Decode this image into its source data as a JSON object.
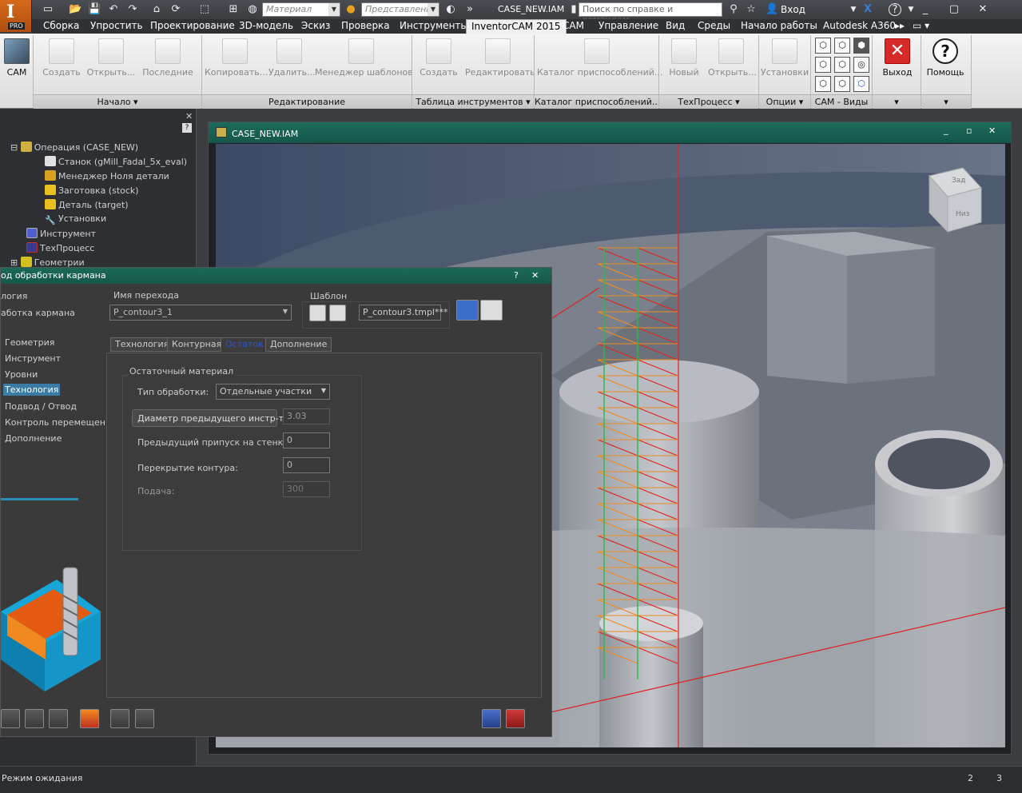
{
  "qat": {
    "material_placeholder": "Материал",
    "appearance_placeholder": "Представлени",
    "doc_title": "CASE_NEW.IAM",
    "help_search_placeholder": "Поиск по справке и командам...",
    "login": "Вход",
    "app_badge": "PRO"
  },
  "tabs": [
    "Сборка",
    "Упростить",
    "Проектирование",
    "3D-модель",
    "Эскиз",
    "Проверка",
    "Инструменты",
    "InventorCAM 2015",
    "CAM",
    "Управление",
    "Вид",
    "Среды",
    "Начало работы",
    "Autodesk A360"
  ],
  "ribbon": {
    "cam": "CAM",
    "create": "Создать",
    "open": "Открыть...",
    "recent": "Последние",
    "copy": "Копировать...",
    "delete": "Удалить...",
    "template_manager": "Менеджер шаблонов",
    "tool_create": "Создать",
    "tool_edit": "Редактировать",
    "fixture_catalog": "Каталог приспособлений...",
    "new": "Новый",
    "open2": "Открыть...",
    "settings": "Установки",
    "exit": "Выход",
    "help": "Помощь",
    "groups": {
      "start": "Начало",
      "editing": "Редактирование",
      "tool_table": "Таблица инструментов",
      "fixture_catalog": "Каталог приспособлений...",
      "techprocess": "ТехПроцесс",
      "options": "Опции",
      "cam_views": "CAM - Виды"
    }
  },
  "tree": {
    "operation": "Операция (CASE_NEW)",
    "machine": "Станок (gMill_Fadal_5x_eval)",
    "zero_manager": "Менеджер Ноля детали",
    "stock": "Заготовка (stock)",
    "target": "Деталь (target)",
    "setups": "Установки",
    "tool": "Инструмент",
    "techprocess": "ТехПроцесс",
    "geometry": "Геометрии"
  },
  "viewwin": {
    "title": "CASE_NEW.IAM",
    "viewcube_top": "Зад",
    "viewcube_bottom": "Низ"
  },
  "dialog": {
    "title": "од обработки кармана",
    "tech_label": "логия",
    "tech_value": "аботка кармана",
    "step_name_label": "Имя перехода",
    "step_name_value": "P_contour3_1",
    "template_label": "Шаблон",
    "template_value": "P_contour3.tmpl***",
    "nav": [
      "Геометрия",
      "Инструмент",
      "Уровни",
      "Технология",
      "Подвод / Отвод",
      "Контроль перемещени",
      "Дополнение"
    ],
    "tabs": [
      "Технология",
      "Контурная",
      "Остаток",
      "Дополнение"
    ],
    "group_title": "Остаточный материал",
    "machining_type_label": "Тип обработки:",
    "machining_type_value": "Отдельные участки",
    "prev_tool_diam_label": "Диаметр предыдущего инстр-та",
    "prev_tool_diam_value": "3.03",
    "prev_wall_allowance_label": "Предыдущий припуск на стенки:",
    "prev_wall_allowance_value": "0",
    "contour_overlap_label": "Перекрытие контура:",
    "contour_overlap_value": "0",
    "feed_label": "Подача:",
    "feed_value": "300"
  },
  "status": {
    "text": "Режим ожидания",
    "n1": "2",
    "n2": "3"
  }
}
